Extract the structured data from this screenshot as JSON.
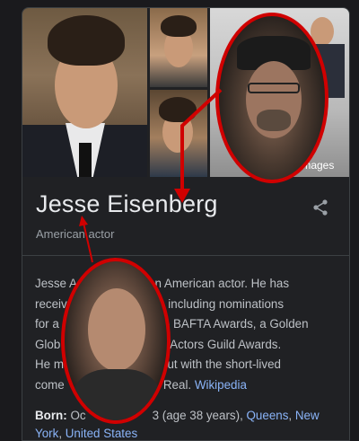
{
  "panel": {
    "more_images_label": "More images",
    "name": "Jesse Eisenberg",
    "subtitle": "American actor",
    "description_parts": [
      "Jesse A",
      " is an American actor. He has",
      "receiv",
      "les, including nominations",
      "for a",
      "o BAFTA Awards, a Golden",
      "Glob",
      "en Actors Guild Awards.",
      "He m",
      "out with the short-lived",
      "come",
      "st Real. "
    ],
    "source_link": "Wikipedia",
    "born_label": "Born:",
    "born_text_1": "Oc",
    "born_text_2": "3 (age 38 years), ",
    "born_link_1": "Queens",
    "born_sep": ", ",
    "born_link_2": "New York",
    "born_sep2": ", ",
    "born_link_3": "United States"
  },
  "colors": {
    "background": "#202124",
    "link": "#8ab4f8",
    "annotation_red": "#d00000"
  },
  "icons": {
    "share": "share-icon",
    "images": "image-icon"
  }
}
